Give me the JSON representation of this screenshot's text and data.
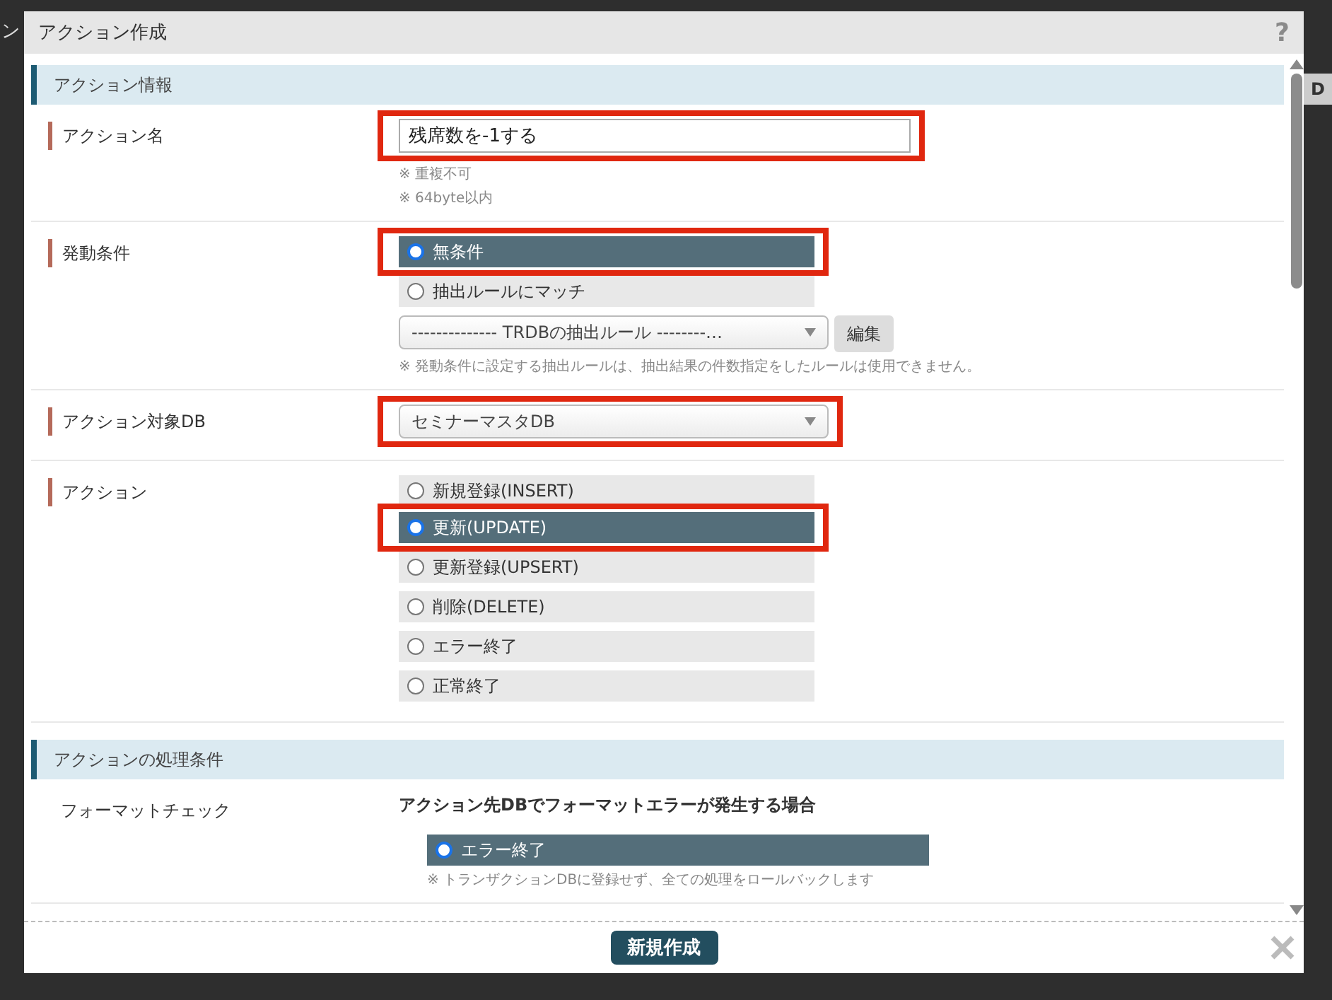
{
  "background": {
    "left_fragment": "ン",
    "right_fragment": "D"
  },
  "dialog": {
    "title": "アクション作成",
    "help": "?"
  },
  "sections": [
    {
      "title": "アクション情報",
      "rows": [
        {
          "kind": "input",
          "label": "アクション名",
          "marker": true,
          "value": "残席数を-1する",
          "highlighted": true,
          "notes": [
            "※ 重複不可",
            "※ 64byte以内"
          ]
        },
        {
          "kind": "radio",
          "label": "発動条件",
          "marker": true,
          "options": [
            {
              "label": "無条件",
              "selected": true,
              "highlighted": true
            },
            {
              "label": "抽出ルールにマッチ",
              "selected": false,
              "highlighted": false
            }
          ],
          "rule_select": "-------------- TRDBの抽出ルール --------…",
          "rule_button": "編集",
          "notes": [
            "※ 発動条件に設定する抽出ルールは、抽出結果の件数指定をしたルールは使用できません。"
          ]
        },
        {
          "kind": "select",
          "label": "アクション対象DB",
          "marker": true,
          "value": "セミナーマスタDB",
          "highlighted": true
        },
        {
          "kind": "radio",
          "label": "アクション",
          "marker": true,
          "options": [
            {
              "label": "新規登録(INSERT)",
              "selected": false,
              "highlighted": false
            },
            {
              "label": "更新(UPDATE)",
              "selected": true,
              "highlighted": true
            },
            {
              "label": "更新登録(UPSERT)",
              "selected": false,
              "highlighted": false
            },
            {
              "label": "削除(DELETE)",
              "selected": false,
              "highlighted": false
            },
            {
              "label": "エラー終了",
              "selected": false,
              "highlighted": false
            },
            {
              "label": "正常終了",
              "selected": false,
              "highlighted": false
            }
          ]
        }
      ]
    },
    {
      "title": "アクションの処理条件",
      "rows": [
        {
          "kind": "radio",
          "label": "フォーマットチェック",
          "marker": false,
          "heading": "アクション先DBでフォーマットエラーが発生する場合",
          "options": [
            {
              "label": "エラー終了",
              "selected": true,
              "highlighted": false
            }
          ],
          "notes": [
            "※ トランザクションDBに登録せず、全ての処理をロールバックします"
          ]
        }
      ]
    }
  ],
  "footer": {
    "button": "新規作成"
  }
}
